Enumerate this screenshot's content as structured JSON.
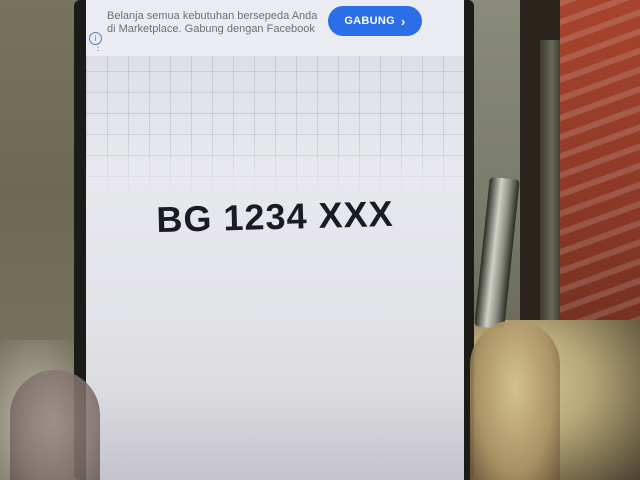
{
  "ad_banner": {
    "message": "Belanja semua kebutuhan bersepeda Anda di Marketplace. Gabung dengan Facebook",
    "button_label": "GABUNG",
    "button_icon": "chevron-right-icon",
    "info_icon": "info-icon",
    "more_icon": "more-vertical-icon",
    "colors": {
      "button_background": "#2a6ee8",
      "button_text": "#ffffff"
    }
  },
  "main": {
    "plate_text": "BG 1234 XXX"
  }
}
